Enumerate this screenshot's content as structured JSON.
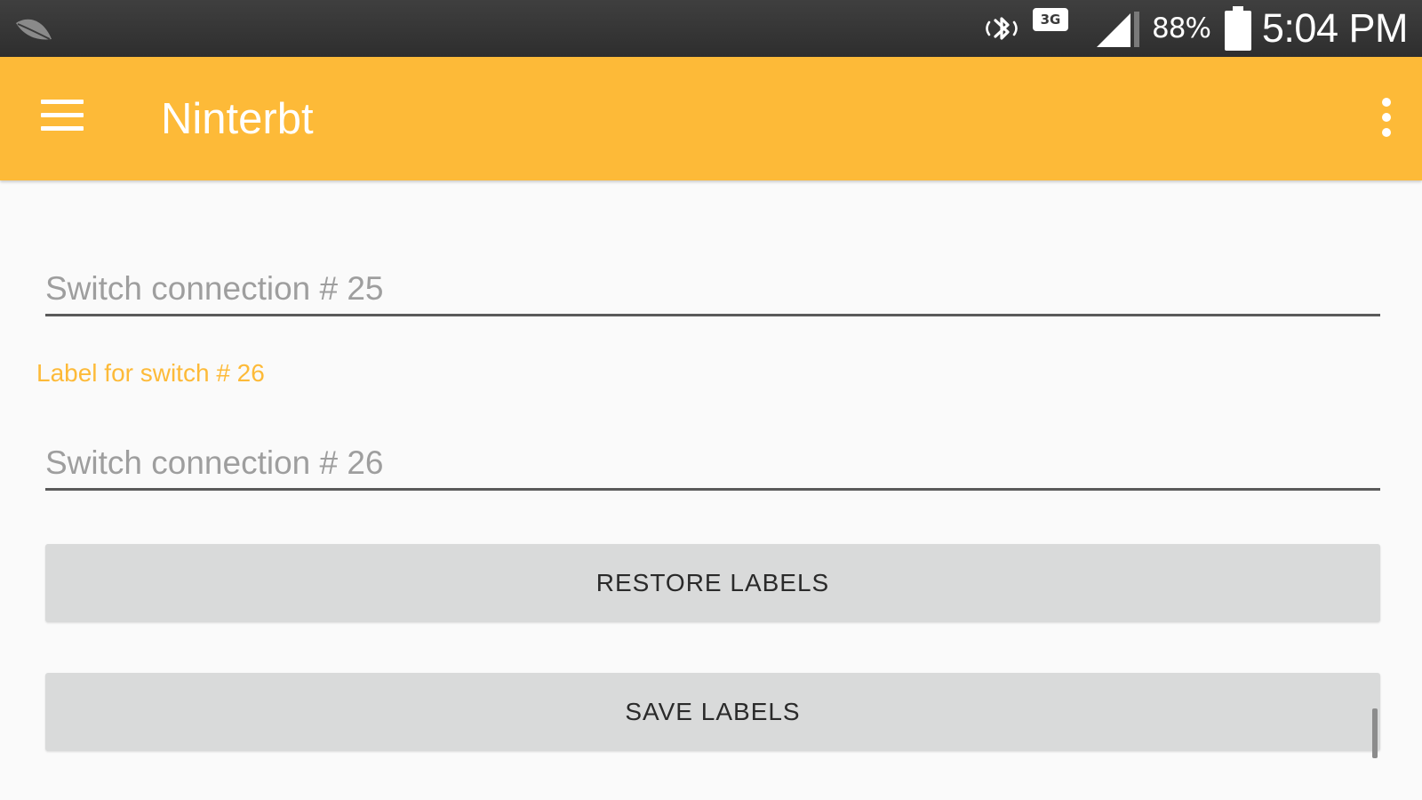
{
  "status_bar": {
    "notification_icon": "leaf-icon",
    "bluetooth_icon": "bluetooth-icon",
    "network_type": "3G",
    "signal_icon": "signal-icon",
    "battery_percent": "88%",
    "battery_icon": "battery-icon",
    "time": "5:04 PM"
  },
  "app_bar": {
    "title": "Ninterbt",
    "menu_icon": "hamburger-menu-icon",
    "overflow_icon": "more-vert-icon",
    "color": "#fdba38"
  },
  "form": {
    "switch_25": {
      "value": "",
      "placeholder": "Switch connection # 25"
    },
    "switch_26": {
      "label": "Label for switch # 26",
      "value": "",
      "placeholder": "Switch connection # 26"
    },
    "restore_label": "RESTORE LABELS",
    "save_label": "SAVE LABELS"
  }
}
